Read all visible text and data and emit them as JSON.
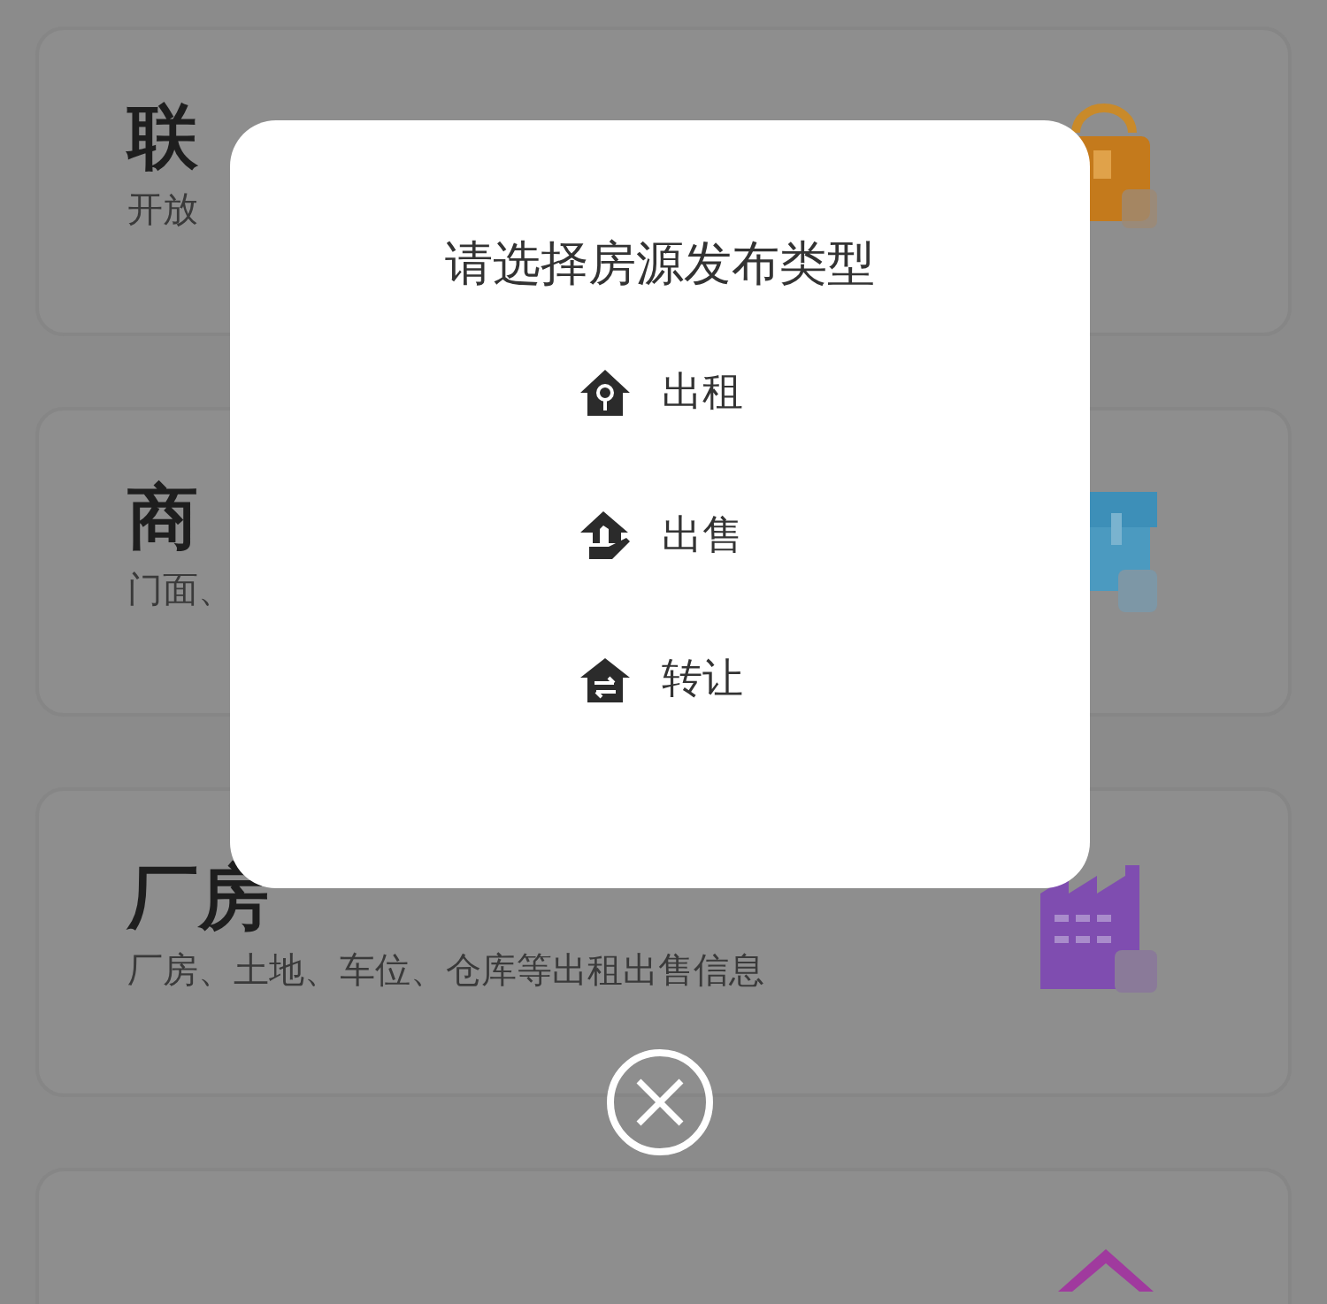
{
  "cards": [
    {
      "kind": "full",
      "title": "联",
      "subtitle": "开放"
    },
    {
      "kind": "full",
      "title": "商",
      "subtitle": "门面、"
    },
    {
      "kind": "full",
      "title": "厂房",
      "subtitle": "厂房、土地、车位、仓库等出租出售信息"
    },
    {
      "kind": "cut"
    }
  ],
  "dialog": {
    "title": "请选择房源发布类型",
    "options": [
      {
        "label": "出租"
      },
      {
        "label": "出售"
      },
      {
        "label": "转让"
      }
    ]
  }
}
